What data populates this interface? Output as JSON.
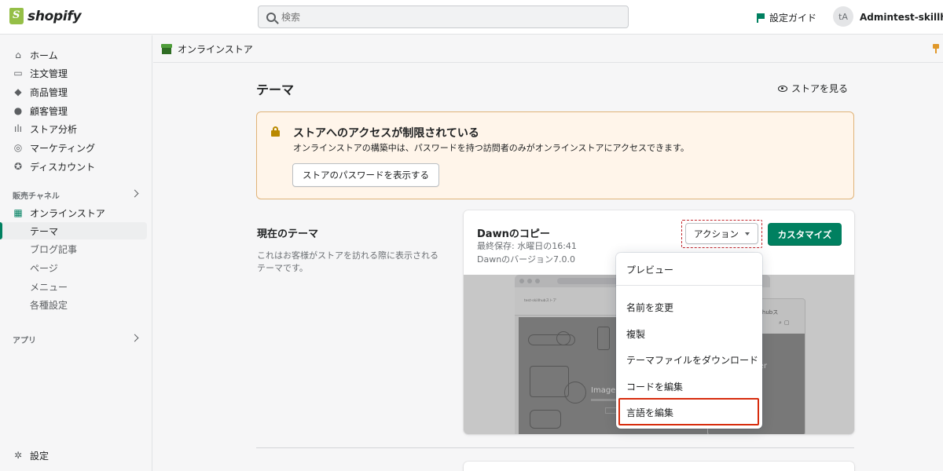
{
  "brand": {
    "logo_text": "shopify",
    "accent": "#008060",
    "logo_color": "#95bf47"
  },
  "topbar": {
    "search_placeholder": "検索",
    "setup_guide": "設定ガイド",
    "user_initials": "tA",
    "user_name": "Admintest-skillhubス"
  },
  "sidebar": {
    "items": [
      {
        "label": "ホーム",
        "icon": "home-icon"
      },
      {
        "label": "注文管理",
        "icon": "orders-icon"
      },
      {
        "label": "商品管理",
        "icon": "tag-icon"
      },
      {
        "label": "顧客管理",
        "icon": "customer-icon"
      },
      {
        "label": "ストア分析",
        "icon": "analytics-icon"
      },
      {
        "label": "マーケティング",
        "icon": "marketing-icon"
      },
      {
        "label": "ディスカウント",
        "icon": "discount-icon"
      }
    ],
    "sales_channels_title": "販売チャネル",
    "online_store": "オンラインストア",
    "sub_items": [
      "テーマ",
      "ブログ記事",
      "ページ",
      "メニュー",
      "各種設定"
    ],
    "apps_title": "アプリ",
    "settings": "設定"
  },
  "breadcrumb": {
    "label": "オンラインストア"
  },
  "main": {
    "title": "テーマ",
    "view_store": "ストアを見る",
    "banner": {
      "title": "ストアへのアクセスが制限されている",
      "text": "オンラインストアの構築中は、パスワードを持つ訪問者のみがオンラインストアにアクセスできます。",
      "button": "ストアのパスワードを表示する"
    },
    "current_theme": {
      "section_title": "現在のテーマ",
      "section_desc": "これはお客様がストアを訪れる際に表示されるテーマです。",
      "name": "Dawnのコピー",
      "last_saved": "最終保存: 水曜日の16:41",
      "version": "Dawnのバージョン7.0.0",
      "actions_label": "アクション",
      "customize_label": "カスタマイズ"
    },
    "preview": {
      "store_name": "test-skillhubストア",
      "hero_text": "Image b",
      "mobile_hero_text": "nner",
      "mobile_header": "llhubス"
    }
  },
  "actions_menu": {
    "items": [
      "プレビュー",
      "名前を変更",
      "複製",
      "テーマファイルをダウンロード",
      "コードを編集",
      "言語を編集"
    ],
    "highlighted": "言語を編集"
  }
}
